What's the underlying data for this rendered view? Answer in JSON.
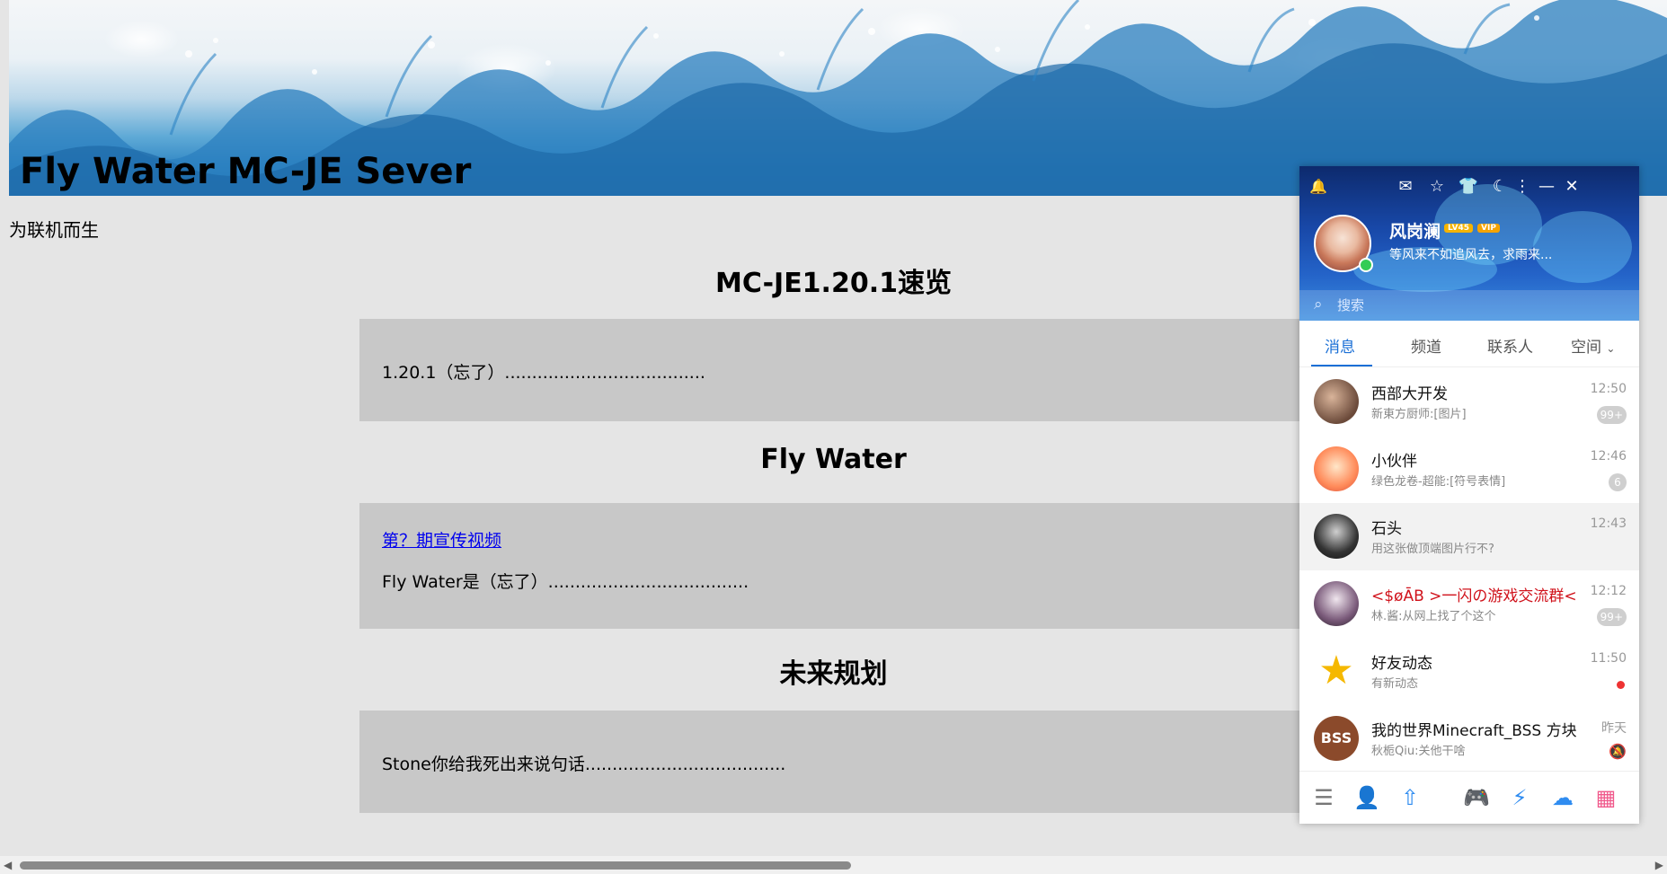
{
  "page": {
    "banner_title": "Fly Water MC-JE Sever",
    "subtitle": "为联机而生",
    "sections": [
      {
        "title": "MC-JE1.20.1速览",
        "text": "1.20.1（忘了）....................................."
      },
      {
        "title": "Fly Water",
        "link": "第？期宣传视频",
        "text": "Fly Water是（忘了）....................................."
      },
      {
        "title": "未来规划",
        "text": "Stone你给我死出来说句话....................................."
      }
    ]
  },
  "qq": {
    "profile": {
      "name": "风岗澜",
      "level_badge": "LV45",
      "vip_badge": "VIP",
      "signature": "等风来不如追风去，求雨来..."
    },
    "search": {
      "placeholder": "搜索"
    },
    "tabs": [
      "消息",
      "频道",
      "联系人",
      "空间"
    ],
    "messages": [
      {
        "name": "西部大开发",
        "preview": "新東方厨师:[图片]",
        "time": "12:50",
        "badge": "99+"
      },
      {
        "name": "小伙伴",
        "preview": "绿色龙卷-超能:[符号表情]",
        "time": "12:46",
        "badge": "6"
      },
      {
        "name": "石头",
        "preview": "用这张做顶端图片行不?",
        "time": "12:43",
        "badge": ""
      },
      {
        "name": "<$øĀB >一闪の游戏交流群<$",
        "preview": "林.酱:从网上找了个这个",
        "time": "12:12",
        "badge": "99+"
      },
      {
        "name": "好友动态",
        "preview": "有新动态",
        "time": "11:50",
        "badge": ""
      },
      {
        "name": "我的世界Minecraft_BSS 方块",
        "preview": "秋栀Qiu:关他干啥",
        "time": "昨天",
        "badge": ""
      }
    ],
    "avatar_texts": {
      "bss": "BSS"
    }
  },
  "colors": {
    "accent": "#1a6fd6",
    "box_bg": "#c8c8c8",
    "page_bg": "#e5e5e5"
  }
}
